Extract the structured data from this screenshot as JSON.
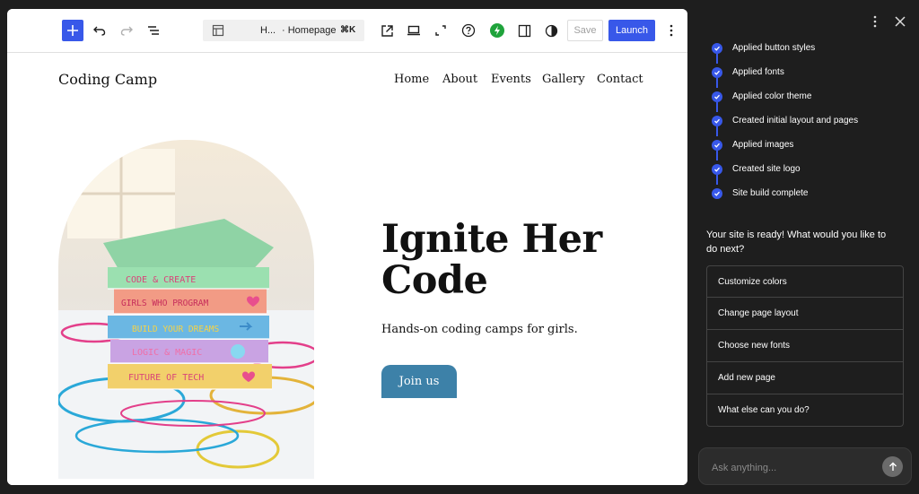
{
  "toolbar": {
    "command_crumb": "H...",
    "command_title": "· Homepage",
    "command_shortcut": "⌘K",
    "save_label": "Save",
    "launch_label": "Launch"
  },
  "site": {
    "title": "Coding Camp",
    "nav": [
      "Home",
      "About",
      "Events",
      "Gallery",
      "Contact"
    ],
    "heading_line1": "Ignite Her",
    "heading_line2": "Code",
    "subheading": "Hands-on coding camps for girls.",
    "cta": "Join us",
    "book_labels": [
      "CODE & CREATE",
      "GIRLS WHO PROGRAM",
      "BUILD YOUR DREAMS",
      "LOGIC & MAGIC",
      "FUTURE OF TECH"
    ]
  },
  "assistant": {
    "steps": [
      "Applied button styles",
      "Applied fonts",
      "Applied color theme",
      "Created initial layout and pages",
      "Applied images",
      "Created site logo",
      "Site build complete"
    ],
    "message": "Your site is ready! What would you like to do next?",
    "suggestions": [
      "Customize colors",
      "Change page layout",
      "Choose new fonts",
      "Add new page",
      "What else can you do?"
    ],
    "input_placeholder": "Ask anything..."
  },
  "colors": {
    "accent": "#3858e9",
    "cta": "#3d81a8",
    "panel_bg": "#1e1e1e",
    "performance_green": "#1fa33b"
  }
}
